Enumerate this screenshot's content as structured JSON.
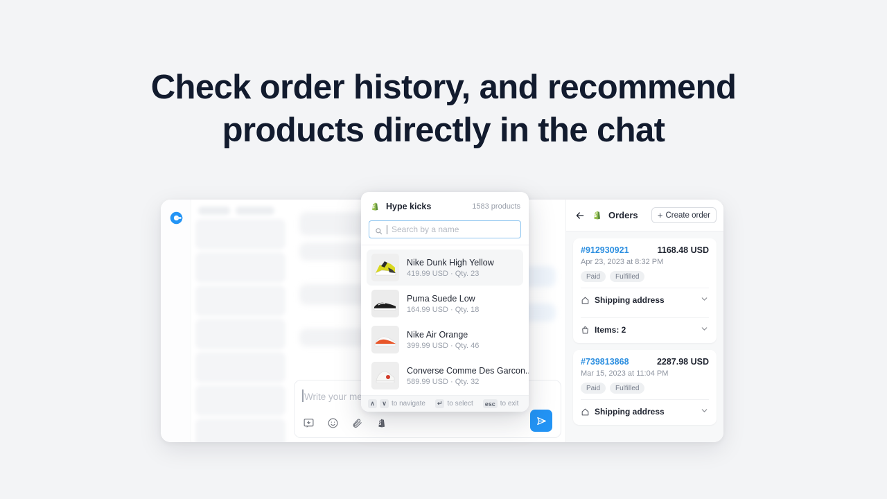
{
  "headline": {
    "line1": "Check order history, and recommend",
    "line2": "products directly in the chat"
  },
  "colors": {
    "page_background": "#f3f4f6",
    "accent_blue": "#2394f5",
    "link_blue": "#2d8fe0",
    "shopify_green": "#95bf47",
    "headline": "#121b2e"
  },
  "composer": {
    "placeholder": "Write your message",
    "tools": [
      {
        "name": "canned-responses-icon",
        "label": "Canned responses"
      },
      {
        "name": "emoji-icon",
        "label": "Emoji"
      },
      {
        "name": "attachment-icon",
        "label": "Attach file"
      },
      {
        "name": "shopify-icon",
        "label": "Shopify"
      }
    ],
    "send_label": "Send"
  },
  "picker": {
    "shop_name": "Hype kicks",
    "product_count": "1583 products",
    "search_placeholder": "Search by a name",
    "search_value": "",
    "products": [
      {
        "name": "Nike Dunk High Yellow",
        "price": "419.99 USD",
        "qty": "Qty. 23",
        "meta": "419.99 USD · Qty. 23",
        "selected": true
      },
      {
        "name": "Puma Suede Low",
        "price": "164.99 USD",
        "qty": "Qty. 18",
        "meta": "164.99 USD · Qty. 18",
        "selected": false
      },
      {
        "name": "Nike Air Orange",
        "price": "399.99 USD",
        "qty": "Qty. 46",
        "meta": "399.99 USD · Qty. 46",
        "selected": false
      },
      {
        "name": "Converse Comme Des Garcon...",
        "price": "589.99 USD",
        "qty": "Qty. 32",
        "meta": "589.99 USD · Qty. 32",
        "selected": false
      }
    ],
    "footer": {
      "navigate_up_key": "∧",
      "navigate_down_key": "∨",
      "navigate_label": "to navigate",
      "select_key": "↵",
      "select_label": "to select",
      "exit_key": "esc",
      "exit_label": "to exit"
    }
  },
  "orders_panel": {
    "title": "Orders",
    "create_order_label": "Create order",
    "create_order_plus": "+",
    "orders": [
      {
        "id": "#912930921",
        "total": "1168.48 USD",
        "date": "Apr 23, 2023 at 8:32 PM",
        "badges": [
          "Paid",
          "Fulfilled"
        ],
        "sections": [
          {
            "icon": "home-icon",
            "label": "Shipping address"
          },
          {
            "icon": "bag-icon",
            "label": "Items: 2"
          }
        ]
      },
      {
        "id": "#739813868",
        "total": "2287.98 USD",
        "date": "Mar 15, 2023 at 11:04 PM",
        "badges": [
          "Paid",
          "Fulfilled"
        ],
        "sections": [
          {
            "icon": "home-icon",
            "label": "Shipping address"
          }
        ]
      }
    ]
  }
}
